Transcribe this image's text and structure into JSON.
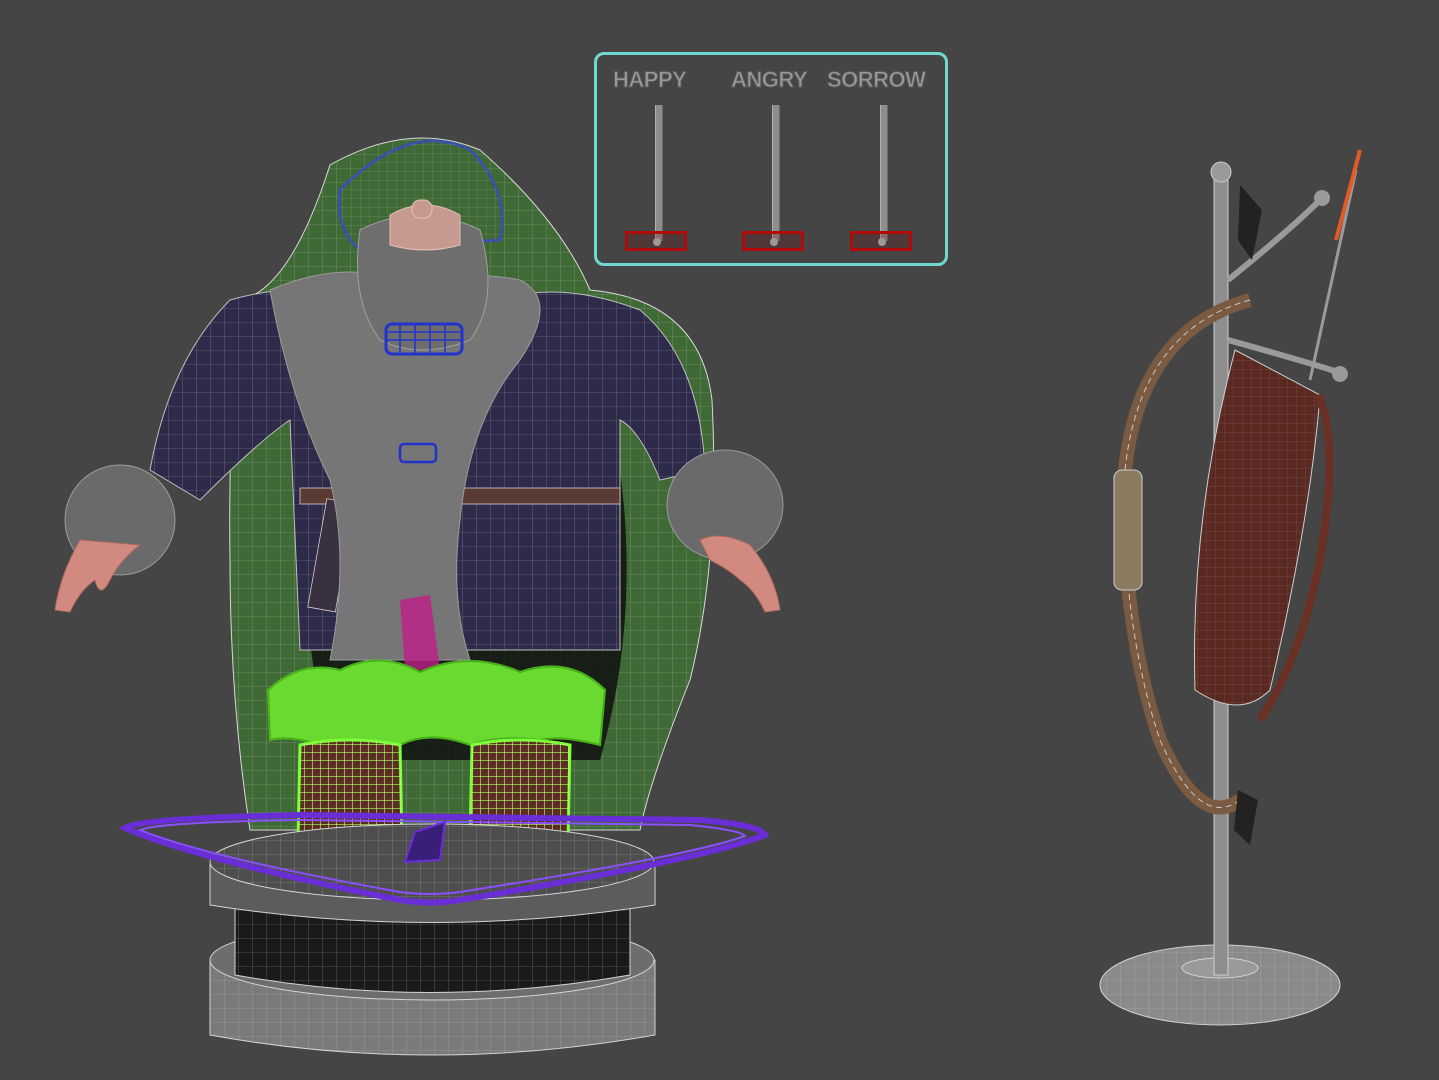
{
  "viewport": {
    "background": "#454545"
  },
  "face_controls": {
    "border_color": "#6fd8cf",
    "sliders": [
      {
        "label": "HAPPY",
        "level": 0.0
      },
      {
        "label": "ANGRY",
        "level": 0.0
      },
      {
        "label": "SORROW",
        "level": 0.0
      }
    ],
    "knob_color": "#b00a0a"
  },
  "scene": {
    "character": "bearded-character-on-pedestal",
    "prop": "bow-and-quiver-stand",
    "colors": {
      "coat": "#2e2a4a",
      "fur": "#7a7a7a",
      "cape_lining": "#3f6a36",
      "selection_green": "#7dff3a",
      "pedestal_outline": "#6a2ed6",
      "wire": "#c9c9c9",
      "bow_wood": "#7a5a40",
      "quiver": "#5a2a22"
    }
  }
}
